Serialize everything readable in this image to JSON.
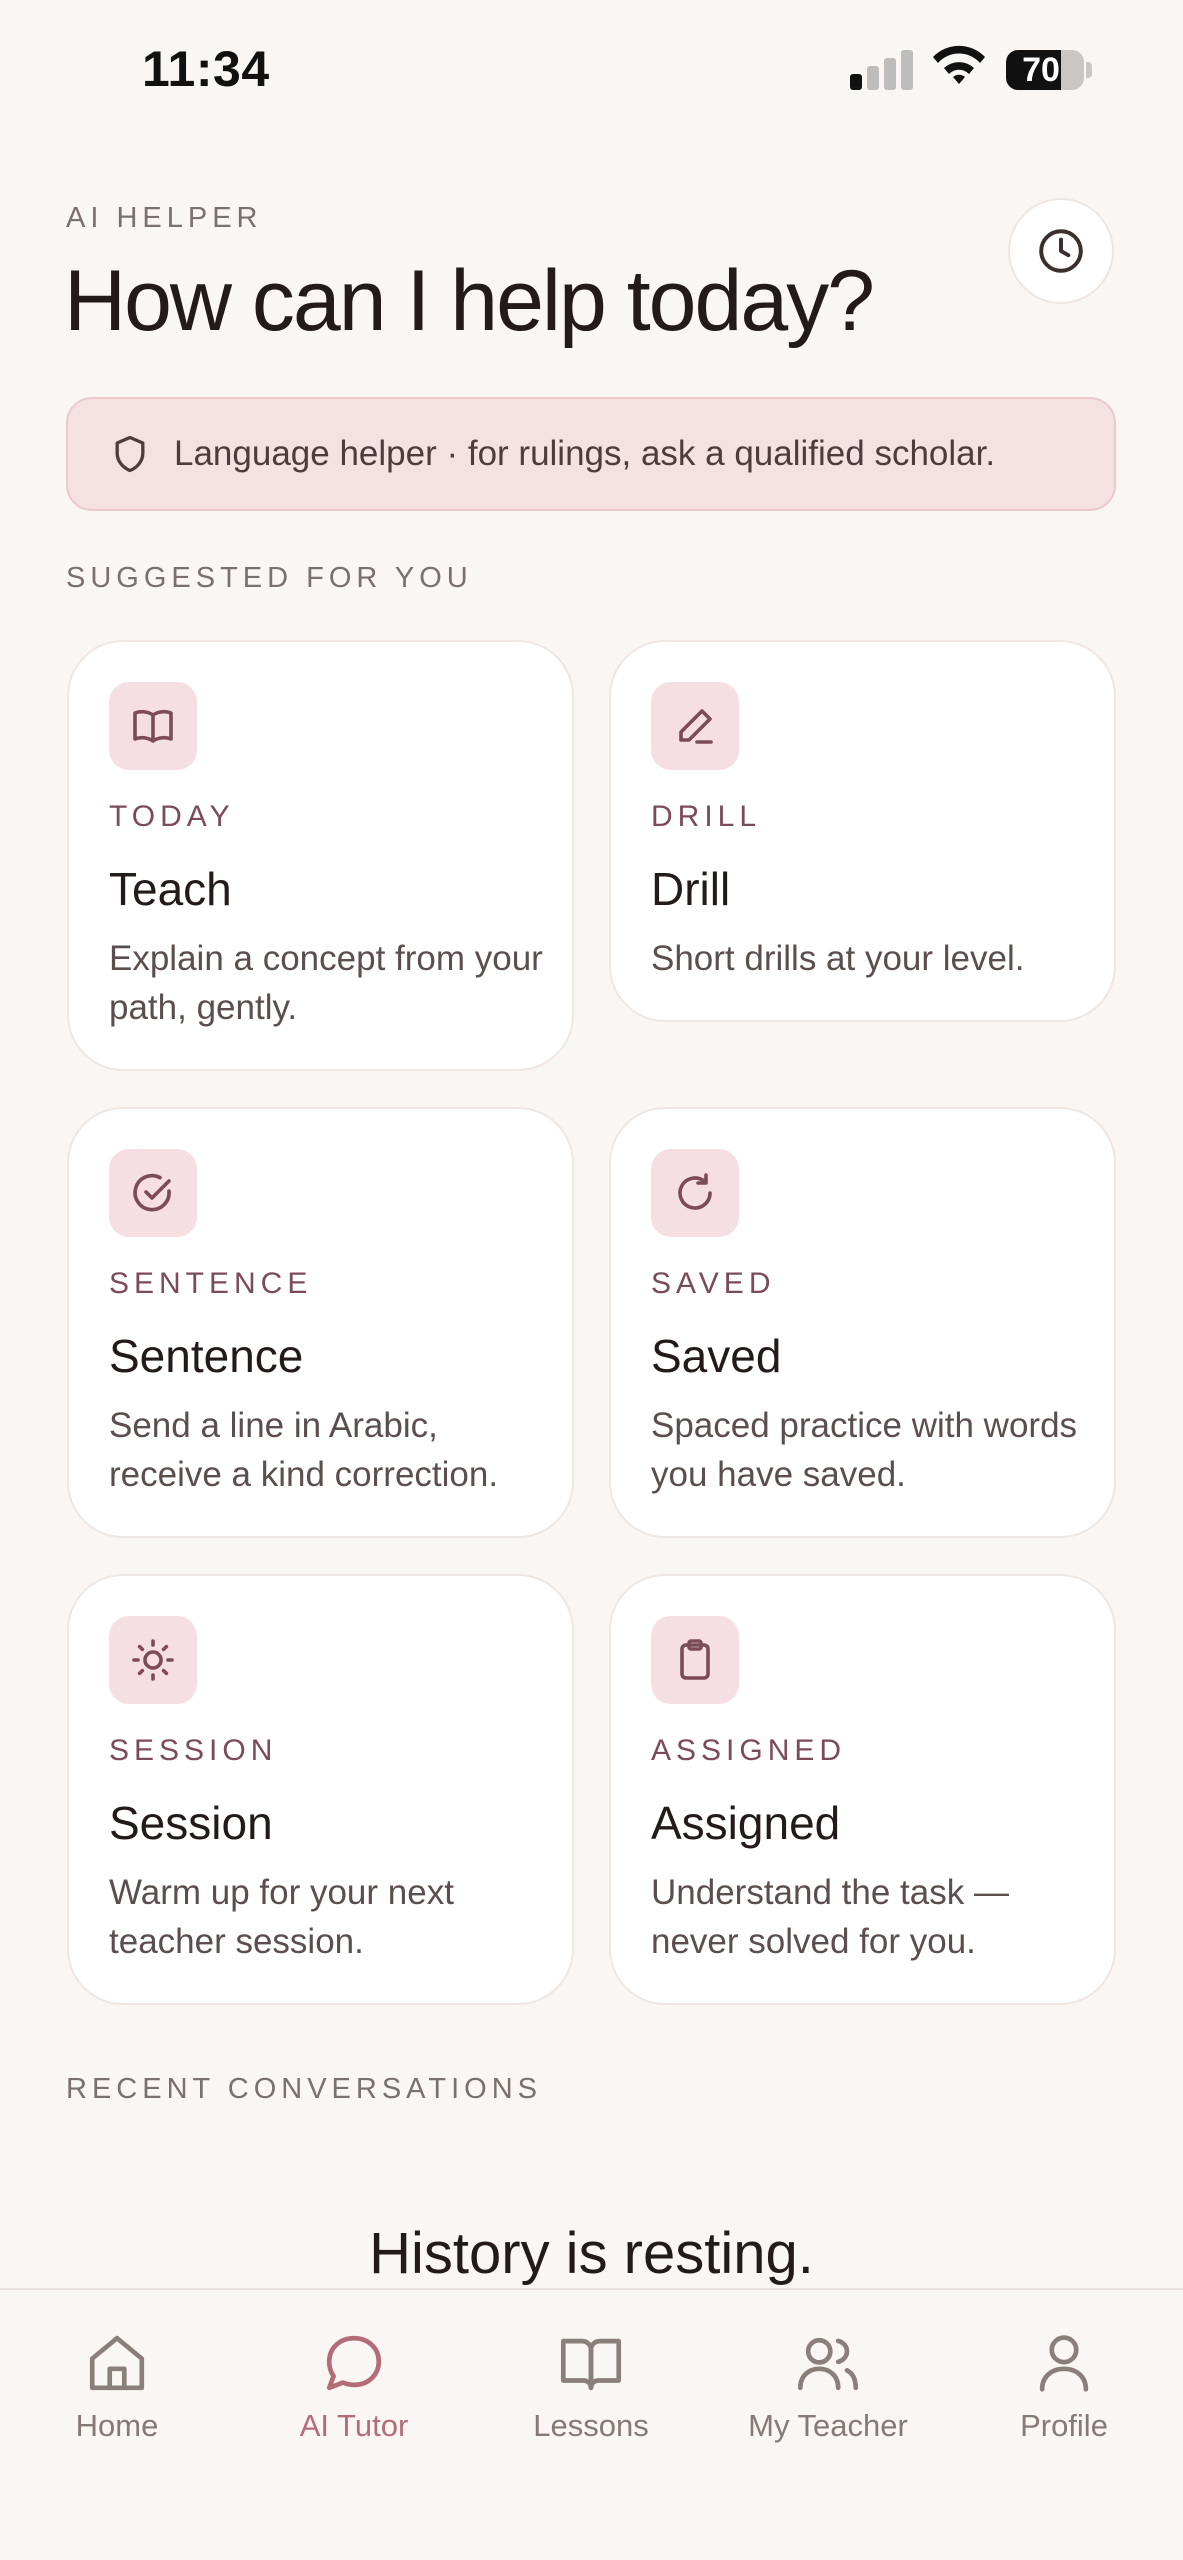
{
  "status_bar": {
    "time": "11:34",
    "battery": "70",
    "battery_level": 0.7
  },
  "header": {
    "eyebrow": "AI HELPER",
    "title": "How can I help today?",
    "history_icon": "clock-icon"
  },
  "disclaimer": {
    "icon": "shield-icon",
    "text": "Language helper · for rulings, ask a qualified scholar."
  },
  "suggested": {
    "label": "SUGGESTED FOR YOU",
    "cards": [
      {
        "icon": "book-open-icon",
        "eyebrow": "TODAY",
        "title": "Teach",
        "description": "Explain a concept from your path, gently."
      },
      {
        "icon": "pencil-icon",
        "eyebrow": "DRILL",
        "title": "Drill",
        "description": "Short drills at your level."
      },
      {
        "icon": "check-circle-icon",
        "eyebrow": "SENTENCE",
        "title": "Sentence",
        "description": "Send a line in Arabic, receive a kind correction."
      },
      {
        "icon": "refresh-icon",
        "eyebrow": "SAVED",
        "title": "Saved",
        "description": "Spaced practice with words you have saved."
      },
      {
        "icon": "sun-icon",
        "eyebrow": "SESSION",
        "title": "Session",
        "description": "Warm up for your next teacher session."
      },
      {
        "icon": "clipboard-icon",
        "eyebrow": "ASSIGNED",
        "title": "Assigned",
        "description": "Understand the task — never solved for you."
      }
    ]
  },
  "recent": {
    "label": "RECENT CONVERSATIONS",
    "empty_title": "History is resting."
  },
  "tab_bar": {
    "active": "AI Tutor",
    "items": [
      {
        "label": "Home",
        "icon": "home-icon"
      },
      {
        "label": "AI Tutor",
        "icon": "chat-bubble-icon"
      },
      {
        "label": "Lessons",
        "icon": "book-icon"
      },
      {
        "label": "My Teacher",
        "icon": "users-icon"
      },
      {
        "label": "Profile",
        "icon": "user-icon"
      }
    ]
  },
  "colors": {
    "accent": "#b46c79",
    "accent_soft": "#f5dfe2",
    "background": "#faf6f3",
    "text": "#221b19"
  }
}
